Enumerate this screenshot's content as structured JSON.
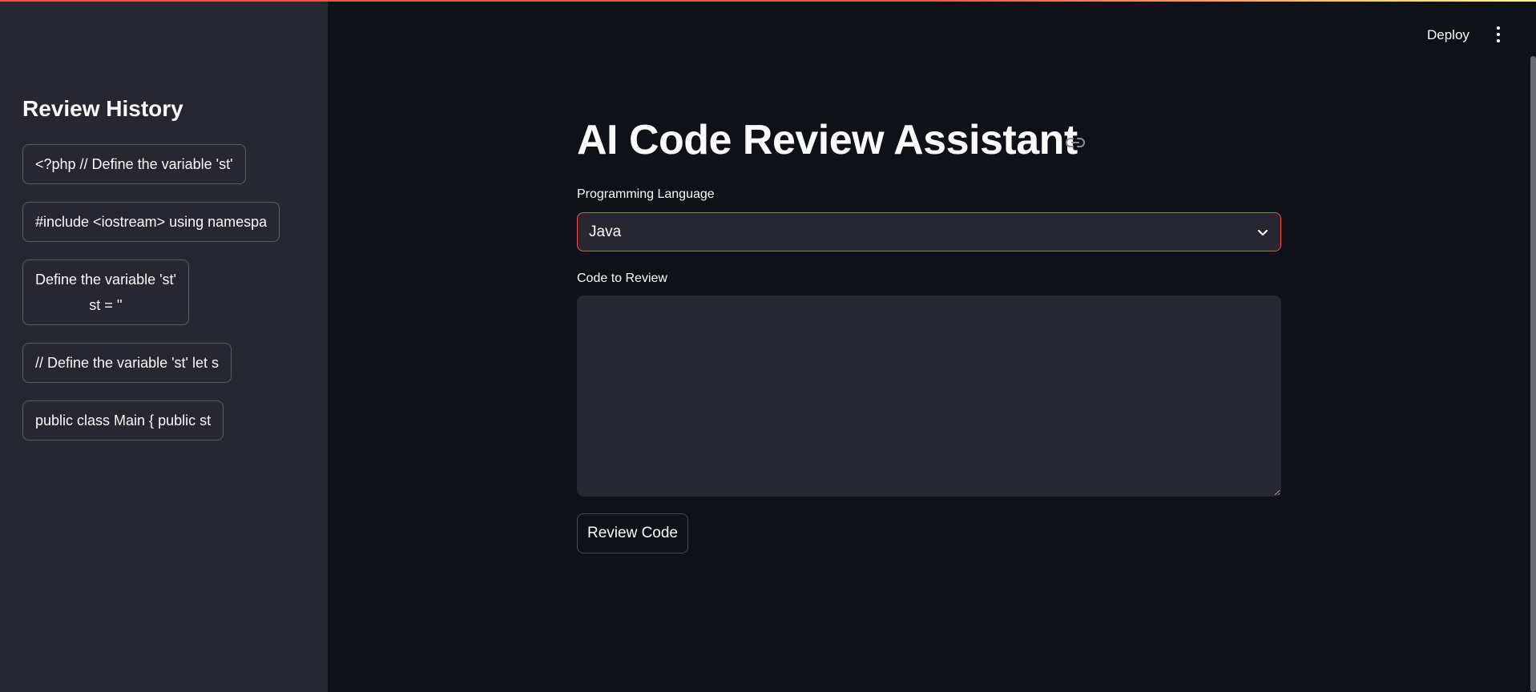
{
  "sidebar": {
    "title": "Review History",
    "items": [
      {
        "label": "<?php // Define the variable 'st'"
      },
      {
        "label": "#include <iostream> using namespa"
      },
      {
        "label": "Define the variable 'st'\nst = ''"
      },
      {
        "label": "// Define the variable 'st' let s"
      },
      {
        "label": "public class Main { public st"
      }
    ]
  },
  "header": {
    "deploy_label": "Deploy",
    "menu_icon": "vertical-dots-icon"
  },
  "main": {
    "title": "AI Code Review Assistant",
    "anchor_icon": "link-icon",
    "language": {
      "label": "Programming Language",
      "selected": "Java"
    },
    "code": {
      "label": "Code to Review",
      "value": ""
    },
    "review_button_label": "Review Code"
  },
  "colors": {
    "background": "#0e1117",
    "sidebar": "#262730",
    "accent": "#ff4b4b",
    "text": "#fafafa"
  }
}
